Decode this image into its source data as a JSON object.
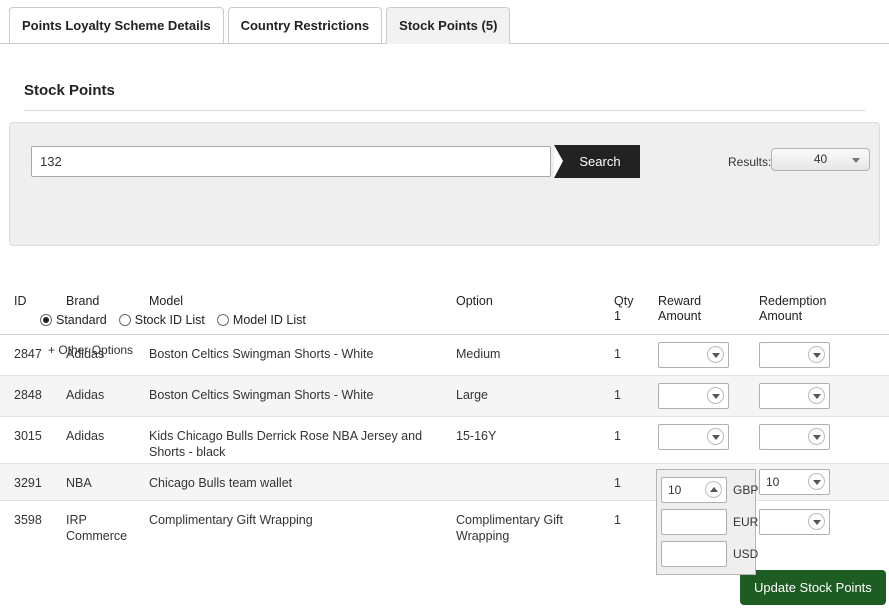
{
  "tabs": [
    {
      "label": "Points Loyalty Scheme Details",
      "active": false
    },
    {
      "label": "Country Restrictions",
      "active": false
    },
    {
      "label": "Stock Points (5)",
      "active": true
    }
  ],
  "section": {
    "title": "Stock Points"
  },
  "search": {
    "value": "132",
    "placeholder": "",
    "button_label": "Search",
    "results_label": "Results:",
    "results_value": "40",
    "other_options_label": "+ Other Options",
    "modes": [
      {
        "label": "Standard",
        "checked": true
      },
      {
        "label": "Stock ID List",
        "checked": false
      },
      {
        "label": "Model ID List",
        "checked": false
      }
    ]
  },
  "table": {
    "headers": {
      "id": "ID",
      "brand": "Brand",
      "model": "Model",
      "option": "Option",
      "qty_line1": "Qty",
      "qty_line2": "1",
      "reward_line1": "Reward",
      "reward_line2": "Amount",
      "redemption_line1": "Redemption",
      "redemption_line2": "Amount"
    },
    "rows": [
      {
        "id": "2847",
        "brand": "Adidas",
        "model": "Boston Celtics Swingman Shorts - White",
        "option": "Medium",
        "qty": "1",
        "reward_amount": "",
        "redemption_amount": ""
      },
      {
        "id": "2848",
        "brand": "Adidas",
        "model": "Boston Celtics Swingman Shorts - White",
        "option": "Large",
        "qty": "1",
        "reward_amount": "",
        "redemption_amount": ""
      },
      {
        "id": "3015",
        "brand": "Adidas",
        "model": "Kids Chicago Bulls Derrick Rose NBA Jersey and Shorts - black",
        "option": "15-16Y",
        "qty": "1",
        "reward_amount": "",
        "redemption_amount": ""
      },
      {
        "id": "3291",
        "brand": "NBA",
        "model": "Chicago Bulls team wallet",
        "option": "",
        "qty": "1",
        "reward_amount": "10",
        "redemption_amount": "10"
      },
      {
        "id": "3598",
        "brand": "IRP Commerce",
        "model": "Complimentary Gift Wrapping",
        "option": "Complimentary Gift Wrapping",
        "qty": "1",
        "reward_amount": "",
        "redemption_amount": ""
      }
    ]
  },
  "currency_panel": {
    "rows": [
      {
        "code": "GBP",
        "value": "10"
      },
      {
        "code": "EUR",
        "value": ""
      },
      {
        "code": "USD",
        "value": ""
      }
    ]
  },
  "footer": {
    "update_label": "Update Stock Points"
  },
  "colors": {
    "accent_button": "#1d5c22",
    "search_button": "#222222",
    "panel_bg": "#efefef",
    "row_alt": "#f5f5f5"
  }
}
